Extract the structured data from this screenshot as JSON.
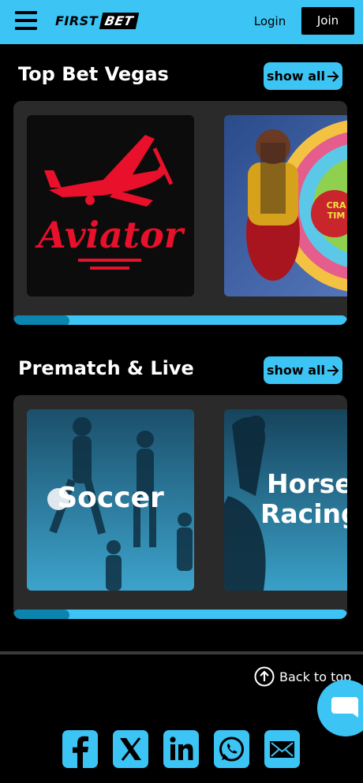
{
  "header": {
    "logo_first": "FIRST",
    "logo_bet": "BET",
    "login_label": "Login",
    "join_label": "Join"
  },
  "sections": [
    {
      "title": "Top Bet Vegas",
      "show_all_label": "show all",
      "cards": [
        {
          "name": "Aviator",
          "label": "Aviator"
        },
        {
          "name": "Crazy Time",
          "label": "CRA TIM"
        }
      ]
    },
    {
      "title": "Prematch & Live",
      "show_all_label": "show all",
      "cards": [
        {
          "name": "Soccer",
          "label": "Soccer"
        },
        {
          "name": "Horse Racing",
          "label_line1": "Horse",
          "label_line2": "Racing"
        }
      ]
    }
  ],
  "footer": {
    "back_to_top_label": "Back to top",
    "socials": [
      "facebook-icon",
      "x-icon",
      "linkedin-icon",
      "whatsapp-icon",
      "email-icon"
    ]
  },
  "colors": {
    "accent": "#3cc4f4",
    "background": "#000000",
    "panel": "#2a2a2a",
    "scroll_thumb": "#0b85ad",
    "aviator_red": "#e8102a"
  }
}
